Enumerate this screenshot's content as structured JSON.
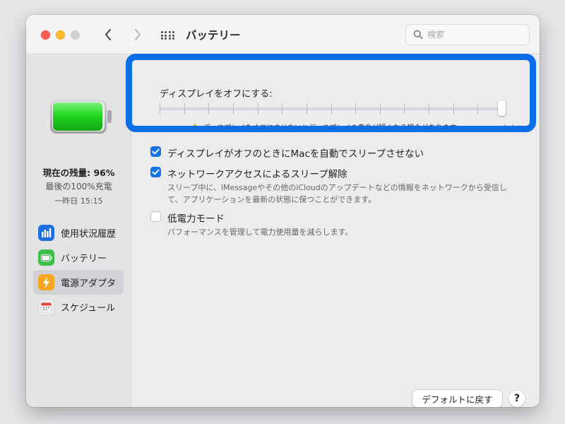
{
  "window": {
    "title": "バッテリー",
    "search_placeholder": "検索"
  },
  "sidebar": {
    "charge_status": "現在の残量: 96%",
    "last_full": "最後の100%充電",
    "last_time": "一昨日 15:15",
    "battery_level": 0.96,
    "items": [
      {
        "label": "使用状況履歴",
        "icon": "bar-chart-icon",
        "color": "#1e6fe0"
      },
      {
        "label": "バッテリー",
        "icon": "battery-icon",
        "color": "#3cc04a"
      },
      {
        "label": "電源アダプタ",
        "icon": "lightning-icon",
        "color": "#f5a623"
      },
      {
        "label": "スケジュール",
        "icon": "calendar-icon",
        "color": "#e8e8ea"
      }
    ],
    "selected_index": 2
  },
  "display": {
    "label": "ディスプレイをオフにする:",
    "warning": "ディスプレイをオフにさせないとディスプレイの寿命が短くなる場合があります",
    "never_label": "しない",
    "slider_value": 1.0
  },
  "options": [
    {
      "label": "ディスプレイがオフのときにMacを自動でスリープさせない",
      "checked": true
    },
    {
      "label": "ネットワークアクセスによるスリープ解除",
      "checked": true,
      "description_1": "スリープ中に、iMessageやその他のiCloudのアップデートなどの情報をネットワークから受信し",
      "description_2": "て、アプリケーションを最新の状態に保つことができます。"
    },
    {
      "label": "低電力モード",
      "checked": false,
      "description_1": "パフォーマンスを管理して電力使用量を減らします。"
    }
  ],
  "buttons": {
    "default_label": "デフォルトに戻す",
    "help_label": "?"
  },
  "colors": {
    "accent": "#1473e6",
    "highlight": "#0a6fe6",
    "battery_green": "#2fd42f"
  }
}
